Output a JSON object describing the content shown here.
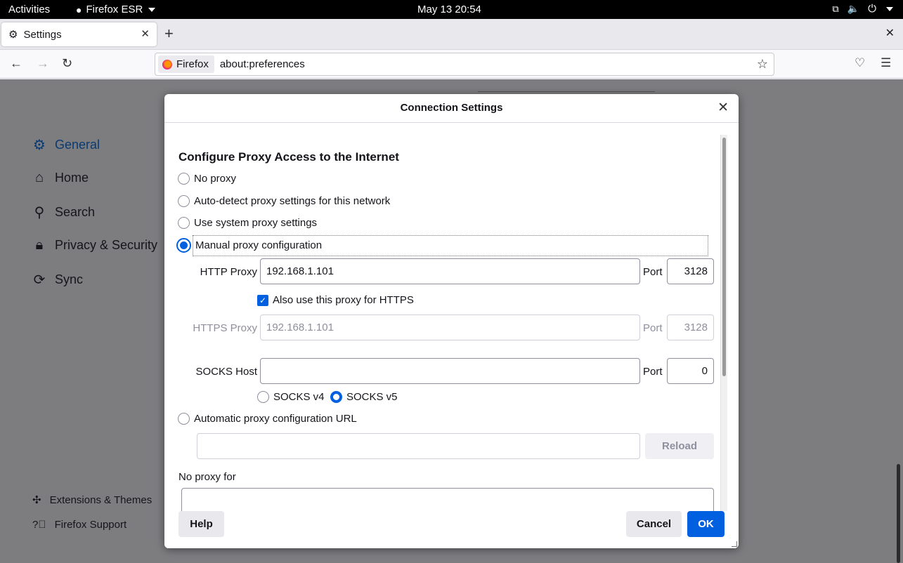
{
  "topbar": {
    "activities": "Activities",
    "app_name": "Firefox ESR",
    "clock": "May 13  20:54"
  },
  "tabs": [
    {
      "label": "Settings"
    }
  ],
  "urlbar": {
    "identity": "Firefox",
    "url": "about:preferences"
  },
  "sidebar": {
    "items": [
      {
        "label": "General"
      },
      {
        "label": "Home"
      },
      {
        "label": "Search"
      },
      {
        "label": "Privacy & Security"
      },
      {
        "label": "Sync"
      }
    ],
    "footer_links": [
      {
        "label": "Extensions & Themes"
      },
      {
        "label": "Firefox Support"
      }
    ]
  },
  "dialog": {
    "title": "Connection Settings",
    "heading": "Configure Proxy Access to the Internet",
    "options": {
      "no_proxy": "No proxy",
      "auto_detect": "Auto-detect proxy settings for this network",
      "system": "Use system proxy settings",
      "manual": "Manual proxy configuration",
      "auto_url": "Automatic proxy configuration URL"
    },
    "selected_option": "manual",
    "http_proxy": {
      "label": "HTTP Proxy",
      "value": "192.168.1.101",
      "port_label": "Port",
      "port": "3128"
    },
    "also_https": {
      "label": "Also use this proxy for HTTPS",
      "checked": true
    },
    "https_proxy": {
      "label": "HTTPS Proxy",
      "value": "192.168.1.101",
      "port_label": "Port",
      "port": "3128"
    },
    "socks": {
      "label": "SOCKS Host",
      "value": "",
      "port_label": "Port",
      "port": "0",
      "v4": "SOCKS v4",
      "v5": "SOCKS v5",
      "selected": "v5"
    },
    "auto_url_value": "",
    "reload": "Reload",
    "no_proxy_for": "No proxy for",
    "buttons": {
      "help": "Help",
      "cancel": "Cancel",
      "ok": "OK"
    }
  },
  "colors": {
    "accent": "#0060df",
    "overlay": "#7d7d80"
  }
}
